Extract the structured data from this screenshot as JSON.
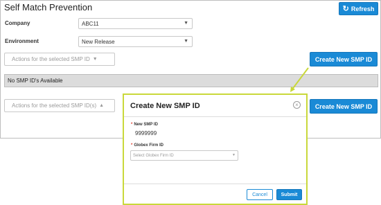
{
  "page": {
    "title": "Self Match Prevention",
    "refresh_label": "Refresh",
    "refresh_icon": "refresh-icon",
    "company_label": "Company",
    "company_value": "ABC11",
    "environment_label": "Environment",
    "environment_value": "New Release",
    "actions_label_top": "Actions for the selected SMP ID",
    "actions_label_bottom": "Actions for the selected SMP ID(s)",
    "create_label": "Create New SMP ID",
    "empty_message": "No SMP ID's Available"
  },
  "modal": {
    "title": "Create New SMP ID",
    "smp_id_label": "New SMP ID",
    "smp_id_value": "9999999",
    "firm_id_label": "Globex Firm ID",
    "firm_id_placeholder": "Select Globex Firm ID",
    "cancel_label": "Cancel",
    "submit_label": "Submit",
    "close_icon": "close-icon"
  },
  "colors": {
    "primary": "#1a8ad6",
    "highlight": "#c9d83a",
    "required": "#e0392b"
  }
}
